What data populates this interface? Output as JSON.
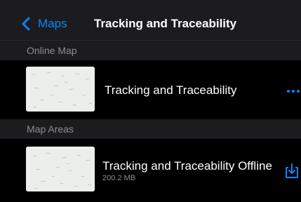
{
  "nav": {
    "back_label": "Maps",
    "title": "Tracking and Traceability",
    "back_icon": "chevron-left-icon"
  },
  "sections": {
    "online": {
      "header": "Online Map",
      "item": {
        "title": "Tracking and Traceability",
        "action_icon": "ellipsis-icon"
      }
    },
    "areas": {
      "header": "Map Areas",
      "item": {
        "title": "Tracking and Traceability Offline",
        "size": "200.2 MB",
        "action_icon": "download-icon"
      }
    }
  },
  "colors": {
    "accent": "#0a84ff",
    "nav_bg": "#1c1c1e",
    "section_bg": "#1c1c1e",
    "row_bg": "#000000",
    "secondary_text": "#8d8d93"
  }
}
